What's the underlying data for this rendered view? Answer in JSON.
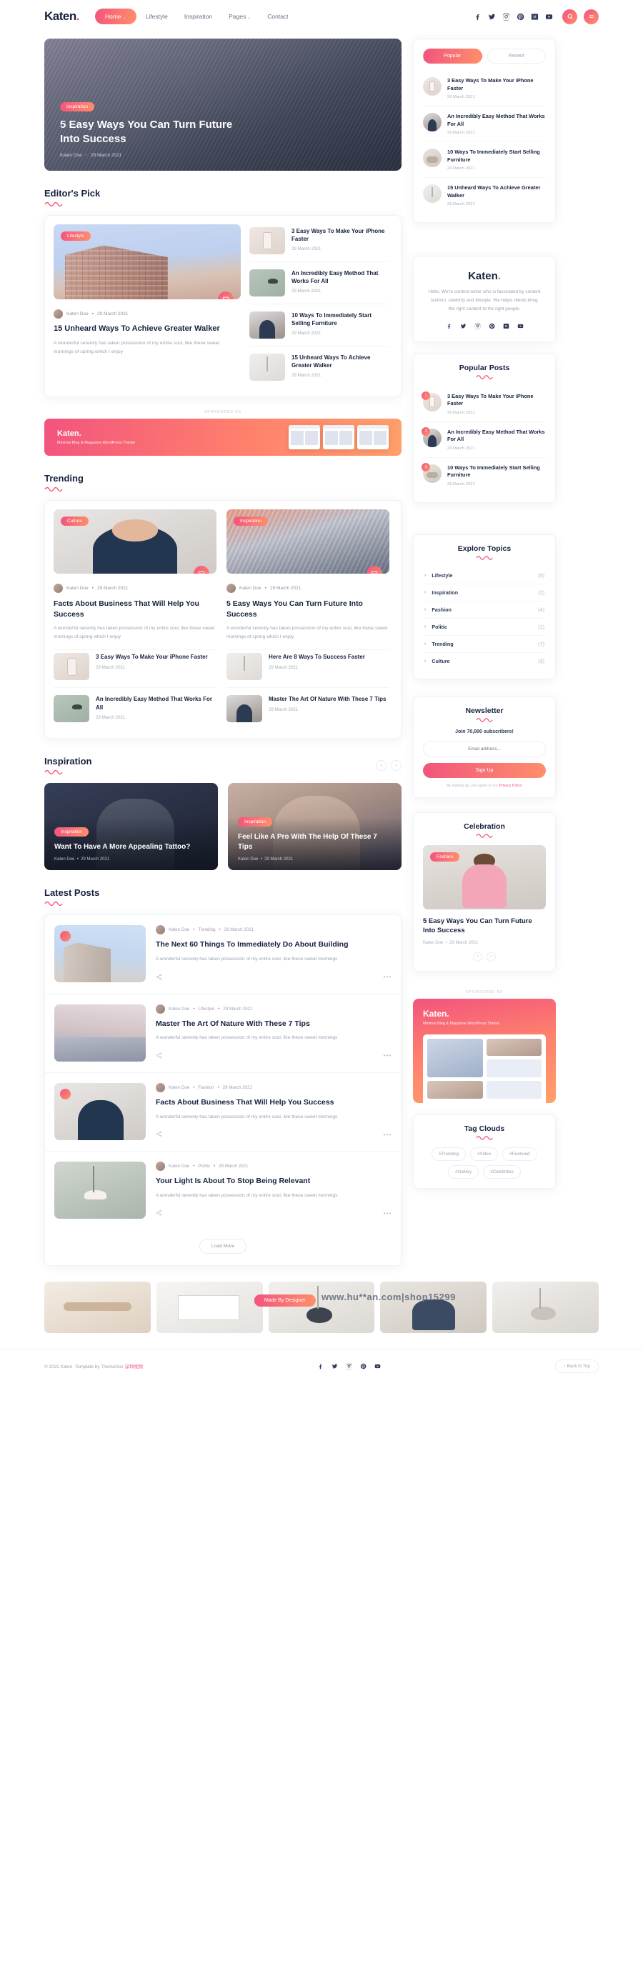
{
  "header": {
    "logo": "Katen",
    "logo_dot": ".",
    "nav": [
      {
        "label": "Home",
        "caret": "⌄",
        "active": true
      },
      {
        "label": "Lifestyle",
        "caret": "",
        "active": false
      },
      {
        "label": "Inspiration",
        "caret": "",
        "active": false
      },
      {
        "label": "Pages",
        "caret": "⌄",
        "active": false
      },
      {
        "label": "Contact",
        "caret": "",
        "active": false
      }
    ],
    "socials": [
      "facebook-icon",
      "twitter-icon",
      "instagram-icon",
      "pinterest-icon",
      "medium-icon",
      "youtube-icon"
    ],
    "search_label": "",
    "menu_label": ""
  },
  "hero": {
    "tag": "Inspiration",
    "title": "5 Easy Ways You Can Turn Future Into Success",
    "author": "Katen Doe",
    "date": "29 March 2021"
  },
  "popular_widget": {
    "tabs": [
      {
        "label": "Popular",
        "active": true
      },
      {
        "label": "Recent",
        "active": false
      }
    ],
    "posts": [
      {
        "title": "3 Easy Ways To Make Your iPhone Faster",
        "date": "29 March 2021",
        "thumb": "pt-phone"
      },
      {
        "title": "An Incredibly Easy Method That Works For All",
        "date": "29 March 2021",
        "thumb": "pt-woman"
      },
      {
        "title": "10 Ways To Immediately Start Selling Furniture",
        "date": "29 March 2021",
        "thumb": "pt-sofa"
      },
      {
        "title": "15 Unheard Ways To Achieve Greater Walker",
        "date": "29 March 2021",
        "thumb": "pt-tool"
      }
    ]
  },
  "editors_pick": {
    "section_title": "Editor's Pick",
    "feature": {
      "tag": "Lifestyle",
      "author": "Katen Doe",
      "date": "29 March 2021",
      "title": "15 Unheard Ways To Achieve Greater Walker",
      "excerpt": "A wonderful serenity has taken possession of my entire soul, like these sweet mornings of spring which I enjoy"
    },
    "list": [
      {
        "title": "3 Easy Ways To Make Your iPhone Faster",
        "date": "29 March 2021",
        "thumb": "im-phone"
      },
      {
        "title": "An Incredibly Easy Method That Works For All",
        "date": "29 March 2021",
        "thumb": "im-lamp"
      },
      {
        "title": "10 Ways To Immediately Start Selling Furniture",
        "date": "29 March 2021",
        "thumb": "im-woman"
      },
      {
        "title": "15 Unheard Ways To Achieve Greater Walker",
        "date": "29 March 2021",
        "thumb": "im-tool"
      }
    ]
  },
  "about_widget": {
    "logo": "Katen",
    "logo_dot": ".",
    "text": "Hello, We're content writer who is fascinated by content fashion, celebrity and lifestyle. We helps clients bring the right content to the right people.",
    "socials": [
      "facebook-icon",
      "twitter-icon",
      "instagram-icon",
      "pinterest-icon",
      "medium-icon",
      "youtube-icon"
    ]
  },
  "popular_posts_widget": {
    "title": "Popular Posts",
    "posts": [
      {
        "num": "1",
        "title": "3 Easy Ways To Make Your iPhone Faster",
        "date": "29 March 2021",
        "thumb": "pt-phone"
      },
      {
        "num": "2",
        "title": "An Incredibly Easy Method That Works For All",
        "date": "29 March 2021",
        "thumb": "pt-woman"
      },
      {
        "num": "3",
        "title": "10 Ways To Immediately Start Selling Furniture",
        "date": "29 March 2021",
        "thumb": "pt-sofa"
      }
    ]
  },
  "sponsored_banner": {
    "label": "SPONSORED AD",
    "logo": "Katen",
    "logo_dot": ".",
    "sub": "Minimal Blog & Magazine WordPress Theme"
  },
  "trending": {
    "section_title": "Trending",
    "cards": [
      {
        "tag": "Culture",
        "author": "Katen Doe",
        "date": "29 March 2021",
        "title": "Facts About Business That Will Help You Success",
        "excerpt": "A wonderful serenity has taken possession of my entire soul, like these sweet mornings of spring which I enjoy",
        "img": "a",
        "subposts": [
          {
            "title": "3 Easy Ways To Make Your iPhone Faster",
            "date": "29 March 2021",
            "thumb": "im-phone"
          },
          {
            "title": "An Incredibly Easy Method That Works For All",
            "date": "29 March 2021",
            "thumb": "im-lamp"
          }
        ]
      },
      {
        "tag": "Inspiration",
        "author": "Katen Doe",
        "date": "29 March 2021",
        "title": "5 Easy Ways You Can Turn Future Into Success",
        "excerpt": "A wonderful serenity has taken possession of my entire soul, like these sweet mornings of spring which I enjoy",
        "img": "b",
        "subposts": [
          {
            "title": "Here Are 8 Ways To Success Faster",
            "date": "29 March 2021",
            "thumb": "im-tool"
          },
          {
            "title": "Master The Art Of Nature With These 7 Tips",
            "date": "29 March 2021",
            "thumb": "im-woman"
          }
        ]
      }
    ]
  },
  "explore_topics": {
    "title": "Explore Topics",
    "items": [
      {
        "label": "Lifestyle",
        "count": "(5)"
      },
      {
        "label": "Inspiration",
        "count": "(2)"
      },
      {
        "label": "Fashion",
        "count": "(4)"
      },
      {
        "label": "Politic",
        "count": "(1)"
      },
      {
        "label": "Trending",
        "count": "(7)"
      },
      {
        "label": "Culture",
        "count": "(3)"
      }
    ]
  },
  "newsletter": {
    "title": "Newsletter",
    "subtitle": "Join 70,000 subscribers!",
    "placeholder": "Email address...",
    "button": "Sign Up",
    "note_pre": "By signing up, you agree to our ",
    "note_link": "Privacy Policy"
  },
  "inspiration": {
    "section_title": "Inspiration",
    "cards": [
      {
        "tag": "Inspiration",
        "title": "Want To Have A More Appealing Tattoo?",
        "author": "Katen Doe",
        "date": "29 March 2021"
      },
      {
        "tag": "Inspiration",
        "title": "Feel Like A Pro With The Help Of These 7 Tips",
        "author": "Katen Doe",
        "date": "29 March 2021"
      }
    ]
  },
  "celebration": {
    "title": "Celebration",
    "tag": "Fashion",
    "post_title": "5 Easy Ways You Can Turn Future Into Success",
    "author": "Katen Doe",
    "date": "29 March 2021"
  },
  "latest_posts": {
    "section_title": "Latest Posts",
    "items": [
      {
        "author": "Katen Doe",
        "category": "Trending",
        "date": "29 March 2021",
        "title": "The Next 60 Things To Immediately Do About Building",
        "excerpt": "A wonderful serenity has taken possession of my entire soul, like these sweet mornings",
        "img": "lp-a",
        "dots": "•••"
      },
      {
        "author": "Katen Doe",
        "category": "Lifestyle",
        "date": "29 March 2021",
        "title": "Master The Art Of Nature With These 7 Tips",
        "excerpt": "A wonderful serenity has taken possession of my entire soul, like these sweet mornings",
        "img": "lp-b",
        "dots": "•••"
      },
      {
        "author": "Katen Doe",
        "category": "Fashion",
        "date": "29 March 2021",
        "title": "Facts About Business That Will Help You Success",
        "excerpt": "A wonderful serenity has taken possession of my entire soul, like these sweet mornings",
        "img": "lp-c",
        "dots": "•••"
      },
      {
        "author": "Katen Doe",
        "category": "Politic",
        "date": "29 March 2021",
        "title": "Your Light Is About To Stop Being Relevant",
        "excerpt": "A wonderful serenity has taken possession of my entire soul, like these sweet mornings",
        "img": "lp-d",
        "dots": "•••"
      }
    ],
    "load_more": "Load More"
  },
  "side_ad": {
    "label": "SPONSORED AD",
    "logo": "Katen",
    "logo_dot": ".",
    "sub": "Minimal Blog & Magazine WordPress Theme"
  },
  "tag_clouds": {
    "title": "Tag Clouds",
    "tags": [
      "#Trending",
      "#Video",
      "#Featured",
      "#Gallery",
      "#Celebrities"
    ]
  },
  "watermark": {
    "pill": "Made By Designer",
    "text": "www.hu**an.com|shop15299"
  },
  "footer": {
    "copyright_pre": "© 2021 Katen ·Template by ThemeGoz ",
    "copyright_cn": "深圳视频",
    "socials": [
      "facebook-icon",
      "twitter-icon",
      "instagram-icon",
      "pinterest-icon",
      "youtube-icon"
    ],
    "back_to_top": "↑ Back to Top"
  },
  "colors": {
    "accent_start": "#f2547d",
    "accent_end": "#ff8f6b",
    "ink": "#16213e",
    "muted": "#9aa1b4"
  }
}
